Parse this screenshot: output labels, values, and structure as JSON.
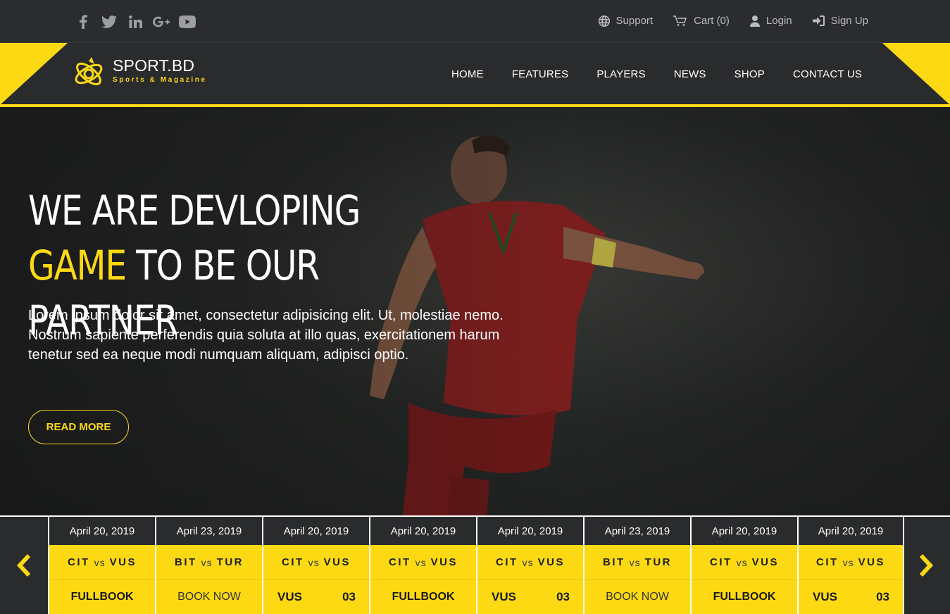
{
  "topbar": {
    "social_icons": [
      "facebook-icon",
      "twitter-icon",
      "linkedin-icon",
      "google-plus-icon",
      "youtube-icon"
    ],
    "links": [
      {
        "icon": "globe-icon",
        "label": "Support"
      },
      {
        "icon": "cart-icon",
        "label": "Cart (0)"
      },
      {
        "icon": "user-icon",
        "label": "Login"
      },
      {
        "icon": "sign-in-icon",
        "label": "Sign Up"
      }
    ]
  },
  "header": {
    "logo_title": "SPORT.BD",
    "logo_subtitle": "Sports & Magazine",
    "nav": [
      "HOME",
      "FEATURES",
      "PLAYERS",
      "NEWS",
      "SHOP",
      "CONTACT US"
    ]
  },
  "hero": {
    "headline_pre": "WE ARE DEVLOPING ",
    "headline_highlight": "GAME",
    "headline_post": " TO BE OUR PARTNER",
    "body": "Lorem ipsum dolor sit amet, consectetur adipisicing elit. Ut, molestiae nemo. Nostrum sapiente perferendis quia soluta at illo quas, exercitationem harum tenetur sed ea neque modi numquam aliquam, adipisci optio.",
    "button": "READ MORE"
  },
  "fixtures": [
    {
      "date": "April 20, 2019",
      "team_a": "CIT",
      "vs": "vs",
      "team_b": "VUS",
      "action": "FULLBOOK",
      "action_type": "bold"
    },
    {
      "date": "April 23, 2019",
      "team_a": "BIT",
      "vs": "vs",
      "team_b": "TUR",
      "action": "BOOK NOW",
      "action_type": "muted"
    },
    {
      "date": "April 20, 2019",
      "team_a": "CIT",
      "vs": "vs",
      "team_b": "VUS",
      "action": "VUS",
      "score": "03",
      "action_type": "score"
    },
    {
      "date": "April 20, 2019",
      "team_a": "CIT",
      "vs": "vs",
      "team_b": "VUS",
      "action": "FULLBOOK",
      "action_type": "bold"
    },
    {
      "date": "April 20, 2019",
      "team_a": "CIT",
      "vs": "vs",
      "team_b": "VUS",
      "action": "VUS",
      "score": "03",
      "action_type": "score"
    },
    {
      "date": "April 23, 2019",
      "team_a": "BIT",
      "vs": "vs",
      "team_b": "TUR",
      "action": "BOOK NOW",
      "action_type": "muted"
    },
    {
      "date": "April 20, 2019",
      "team_a": "CIT",
      "vs": "vs",
      "team_b": "VUS",
      "action": "FULLBOOK",
      "action_type": "bold"
    },
    {
      "date": "April 20, 2019",
      "team_a": "CIT",
      "vs": "vs",
      "team_b": "VUS",
      "action": "VUS",
      "score": "03",
      "action_type": "score"
    }
  ],
  "colors": {
    "accent": "#fdd914",
    "dark": "#2a2b2d"
  }
}
